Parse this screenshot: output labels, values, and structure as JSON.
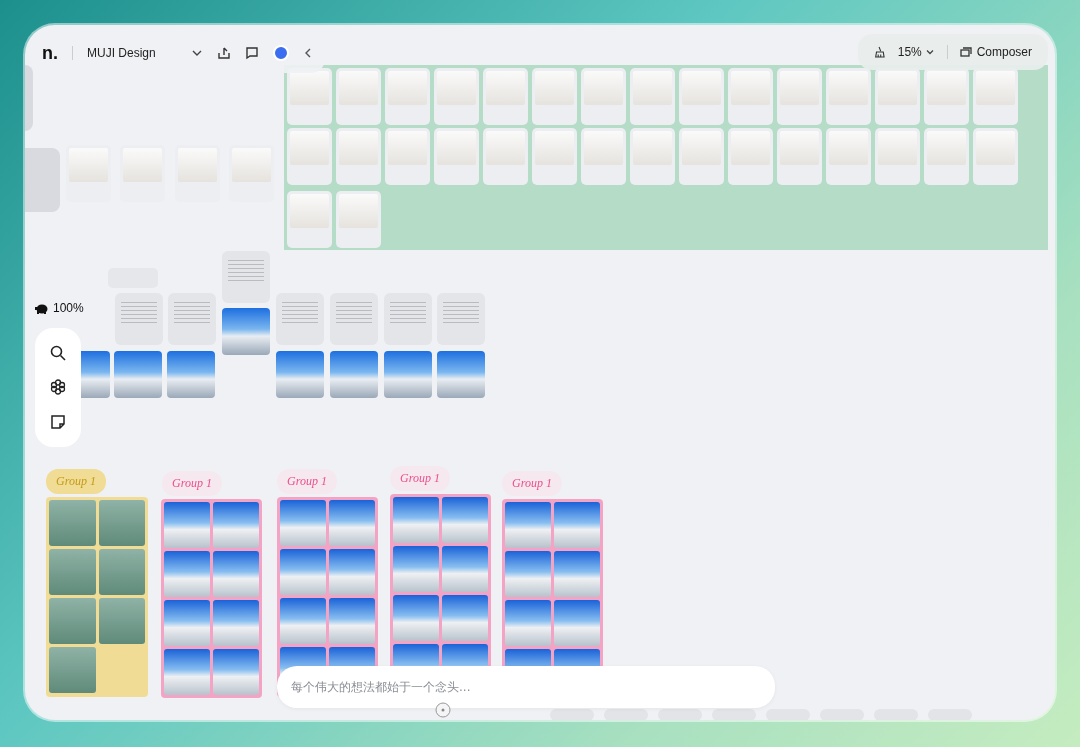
{
  "toolbar": {
    "logo": "n.",
    "project_name": "MUJI Design"
  },
  "view_controls": {
    "zoom": "15%",
    "composer_label": "Composer"
  },
  "minimap": {
    "zoom": "100%"
  },
  "groups": [
    {
      "label": "Group 1",
      "color": "#f0dc94"
    },
    {
      "label": "Group 1",
      "color": "#f4a3c4"
    },
    {
      "label": "Group 1",
      "color": "#f4a3c4"
    },
    {
      "label": "Group 1",
      "color": "#f4a3c4"
    },
    {
      "label": "Group 1",
      "color": "#f4a3c4"
    }
  ],
  "prompt": {
    "placeholder": "每个伟大的想法都始于一个念头..."
  }
}
